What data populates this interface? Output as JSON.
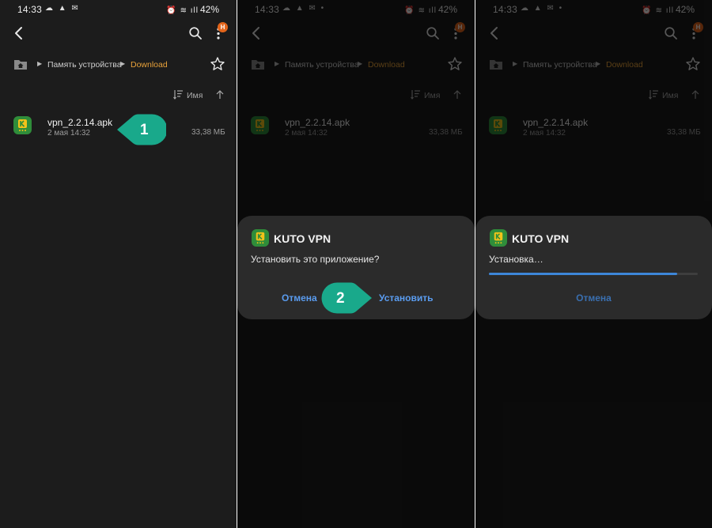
{
  "status_bar": {
    "time": "14:33",
    "battery": "42%",
    "left_icons_0": "☁ ▲ ✉",
    "left_icons_1": "☁ ▲ ✉ •",
    "right_icons": "⏰ ≋ ıll"
  },
  "file_manager": {
    "path_root": "Память устройства",
    "path_current": "Download",
    "sort_label": "Имя",
    "badge": "Н",
    "file": {
      "name": "vpn_2.2.14.apk",
      "date": "2 мая 14:32",
      "size": "33,38 МБ"
    }
  },
  "install_dialog": {
    "app_name": "KUTO VPN",
    "question": "Установить это приложение?",
    "cancel": "Отмена",
    "install": "Установить"
  },
  "progress_dialog": {
    "app_name": "KUTO VPN",
    "status": "Установка…",
    "progress": 0.9,
    "cancel": "Отмена"
  },
  "callouts": {
    "step1": "1",
    "step2": "2"
  },
  "colors": {
    "background": "#1c1c1c",
    "dialog": "#2b2b2b",
    "accent_blue": "#5a9cf0",
    "path_orange": "#e9a23a",
    "callout_teal": "#19a98b",
    "app_green": "#2f8d3a",
    "badge_orange": "#e3651b"
  }
}
